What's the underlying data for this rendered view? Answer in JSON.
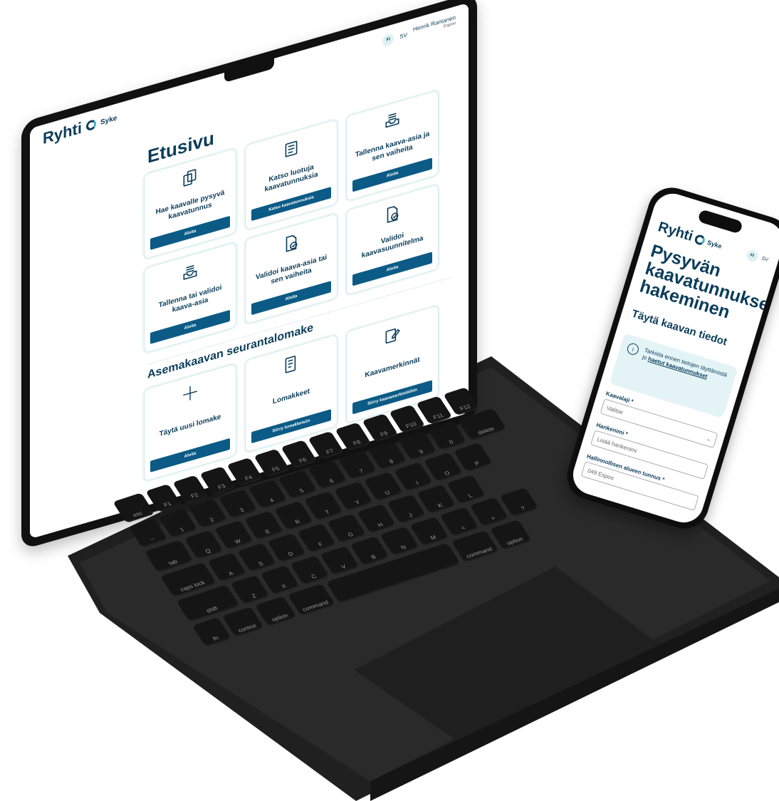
{
  "laptop": {
    "header": {
      "logo": "Ryhti",
      "logo_sub": "Syke",
      "lang_fi": "FI",
      "lang_sv": "SV",
      "user_name": "Henrik Rantanen",
      "user_sub": "Espoo"
    },
    "page_title": "Etusivu",
    "cards": [
      {
        "title": "Hae kaavalle pysyvä kaavatunnus",
        "button": "Aloita",
        "icon": "document-stack-icon"
      },
      {
        "title": "Katso luotuja kaavatunnuksia",
        "button": "Katso kaavatunnuksia",
        "icon": "list-document-icon"
      },
      {
        "title": "Tallenna kaava-asia ja sen vaiheita",
        "button": "Aloita",
        "icon": "inbox-icon"
      },
      {
        "title": "Tallenna tai validoi kaava-asia",
        "button": "Aloita",
        "icon": "inbox-icon"
      },
      {
        "title": "Validoi kaava-asia tai sen vaiheita",
        "button": "Aloita",
        "icon": "check-document-icon"
      },
      {
        "title": "Validoi kaavasuunnitelma",
        "button": "Aloita",
        "icon": "check-document-icon"
      }
    ],
    "section_title": "Asemakaavan seurantalomake",
    "cards2": [
      {
        "title": "Täytä uusi lomake",
        "button": "Aloita",
        "icon": "plus-icon"
      },
      {
        "title": "Lomakkeet",
        "button": "Siirry lomakkeisiin",
        "icon": "form-icon"
      },
      {
        "title": "Kaavamerkinnät",
        "button": "Siirry kaavamerkintöihin",
        "icon": "edit-icon"
      }
    ]
  },
  "keyboard": {
    "rows": [
      [
        "esc",
        "F1",
        "F2",
        "F3",
        "F4",
        "F5",
        "F6",
        "F7",
        "F8",
        "F9",
        "F10",
        "F11",
        "F12"
      ],
      [
        "~",
        "1",
        "2",
        "3",
        "4",
        "5",
        "6",
        "7",
        "8",
        "9",
        "0",
        "delete"
      ],
      [
        "tab",
        "Q",
        "W",
        "E",
        "R",
        "T",
        "Y",
        "U",
        "I",
        "O",
        "P"
      ],
      [
        "caps lock",
        "A",
        "S",
        "D",
        "F",
        "G",
        "H",
        "J",
        "K",
        "L"
      ],
      [
        "shift",
        "Z",
        "X",
        "C",
        "V",
        "B",
        "N",
        "M",
        "<",
        ">",
        "?"
      ],
      [
        "fn",
        "control",
        "option",
        "command",
        "command",
        "option"
      ]
    ]
  },
  "phone": {
    "logo": "Ryhti",
    "logo_sub": "Syke",
    "lang_fi": "FI",
    "lang_sv": "SV",
    "title": "Pysyvän kaavatunnuksen hakeminen",
    "subtitle": "Täytä kaavan tiedot",
    "info_text": "Tarkista ennen tietojen täyttämistä",
    "info_link_prefix": "jo",
    "info_link": "haetut kaavatunnukset",
    "fields": [
      {
        "label": "Kaavalaji *",
        "placeholder": "Valitse"
      },
      {
        "label": "Hankenimi *",
        "placeholder": "Lisää hankenimi"
      },
      {
        "label": "Hallinnollisen alueen tunnus *",
        "placeholder": "049  Espoo"
      }
    ]
  }
}
